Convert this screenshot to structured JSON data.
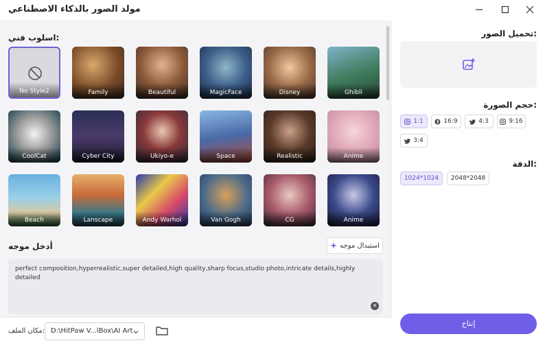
{
  "app": {
    "title": "مولد الصور بالذكاء الاصطناعي"
  },
  "style_section": {
    "label": "اسلوب فني:"
  },
  "styles": [
    {
      "label": "No Style2",
      "selected": true
    },
    {
      "label": "Family"
    },
    {
      "label": "Beautiful"
    },
    {
      "label": "MagicFace"
    },
    {
      "label": "Disney"
    },
    {
      "label": "Ghibli"
    },
    {
      "label": "CoolCat"
    },
    {
      "label": "Cyber City"
    },
    {
      "label": "Ukiyo-e"
    },
    {
      "label": "Space"
    },
    {
      "label": "Realistic"
    },
    {
      "label": "Anime"
    },
    {
      "label": "Beach"
    },
    {
      "label": "Lanscape"
    },
    {
      "label": "Andy Warhol"
    },
    {
      "label": "Van Gogh"
    },
    {
      "label": "CG"
    },
    {
      "label": "Anime"
    }
  ],
  "prompt": {
    "label": "أدخل موجه",
    "suggest_label": "استبدال موجه",
    "text": "perfect composition,hyperrealistic,super detailed,high quality,sharp focus,studio photo,intricate details,highly detailed"
  },
  "output": {
    "label": "مكان الملف:",
    "path": "D:\\HitPaw V...lBox\\AI Art"
  },
  "upload": {
    "label": "تحميل الصور:"
  },
  "size": {
    "label": "حجم الصورة:",
    "options": [
      "1:1",
      "16:9",
      "4:3",
      "9:16",
      "3:4"
    ],
    "selected": "1:1"
  },
  "resolution": {
    "label": "الدقة:",
    "options": [
      "1024*1024",
      "2048*2048"
    ],
    "selected": "1024*1024"
  },
  "actions": {
    "generate_label": "إنتاج"
  },
  "colors": {
    "accent": "#6f5ee8",
    "selected_border": "#6b63d8"
  }
}
